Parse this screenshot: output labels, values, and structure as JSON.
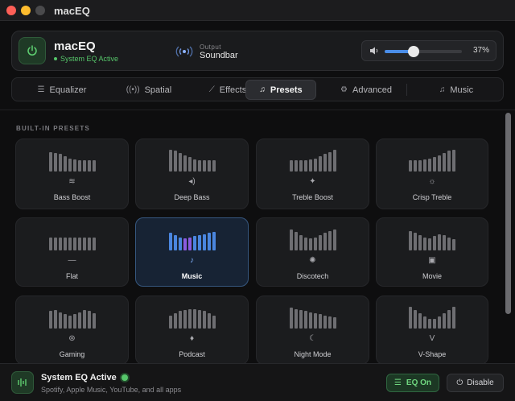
{
  "window": {
    "title": "macEQ"
  },
  "header": {
    "app_name": "macEQ",
    "status": "System EQ Active",
    "output_caption": "Output",
    "output_device": "Soundbar",
    "volume_percent": 37,
    "volume_label": "37%"
  },
  "tabs": [
    {
      "label": "Equalizer",
      "icon": "sliders-icon",
      "glyph": "☰"
    },
    {
      "label": "Spatial",
      "icon": "spatial-audio-icon",
      "glyph": "((•))"
    },
    {
      "label": "Effects",
      "icon": "magic-wand-icon",
      "glyph": "⟋"
    },
    {
      "label": "Presets",
      "icon": "music-list-icon",
      "glyph": "♫",
      "active": true
    },
    {
      "label": "Advanced",
      "icon": "advanced-icon",
      "glyph": "⚙"
    },
    {
      "label": "Music",
      "icon": "music-note-icon",
      "glyph": "♫"
    }
  ],
  "section_label": "BUILT-IN PRESETS",
  "presets": [
    {
      "label": "Bass Boost",
      "icon": "waveform-icon",
      "glyph": "≋",
      "levels": [
        0.9,
        0.85,
        0.8,
        0.7,
        0.6,
        0.55,
        0.5,
        0.5,
        0.5,
        0.5
      ]
    },
    {
      "label": "Deep Bass",
      "icon": "speaker-wave-icon",
      "glyph": "◂)",
      "levels": [
        1.0,
        0.95,
        0.85,
        0.75,
        0.65,
        0.55,
        0.5,
        0.5,
        0.5,
        0.5
      ]
    },
    {
      "label": "Treble Boost",
      "icon": "sparkle-icon",
      "glyph": "✦",
      "levels": [
        0.5,
        0.5,
        0.5,
        0.5,
        0.55,
        0.6,
        0.7,
        0.8,
        0.9,
        1.0
      ]
    },
    {
      "label": "Crisp Treble",
      "icon": "sun-rays-icon",
      "glyph": "☼",
      "levels": [
        0.5,
        0.5,
        0.5,
        0.55,
        0.6,
        0.65,
        0.75,
        0.85,
        0.95,
        1.0
      ]
    },
    {
      "label": "Flat",
      "icon": "minus-icon",
      "glyph": "—",
      "levels": [
        0.6,
        0.6,
        0.6,
        0.6,
        0.6,
        0.6,
        0.6,
        0.6,
        0.6,
        0.6
      ]
    },
    {
      "label": "Music",
      "icon": "music-note-icon",
      "glyph": "♪",
      "selected": true,
      "levels": [
        0.8,
        0.7,
        0.6,
        0.55,
        0.6,
        0.65,
        0.7,
        0.75,
        0.8,
        0.85
      ]
    },
    {
      "label": "Discotech",
      "icon": "party-popper-icon",
      "glyph": "✺",
      "levels": [
        0.95,
        0.85,
        0.7,
        0.6,
        0.55,
        0.6,
        0.7,
        0.8,
        0.9,
        0.95
      ]
    },
    {
      "label": "Movie",
      "icon": "film-icon",
      "glyph": "▣",
      "levels": [
        0.9,
        0.8,
        0.7,
        0.6,
        0.55,
        0.65,
        0.75,
        0.7,
        0.6,
        0.5
      ]
    },
    {
      "label": "Gaming",
      "icon": "gamepad-icon",
      "glyph": "⊛",
      "levels": [
        0.8,
        0.85,
        0.75,
        0.65,
        0.6,
        0.65,
        0.75,
        0.85,
        0.8,
        0.7
      ]
    },
    {
      "label": "Podcast",
      "icon": "microphone-icon",
      "glyph": "♦",
      "levels": [
        0.6,
        0.7,
        0.8,
        0.85,
        0.9,
        0.9,
        0.85,
        0.8,
        0.7,
        0.6
      ]
    },
    {
      "label": "Night Mode",
      "icon": "moon-icon",
      "glyph": "☾",
      "levels": [
        0.95,
        0.9,
        0.85,
        0.8,
        0.75,
        0.7,
        0.65,
        0.6,
        0.55,
        0.5
      ]
    },
    {
      "label": "V-Shape",
      "icon": "v-shape-icon",
      "glyph": "V",
      "levels": [
        1.0,
        0.85,
        0.7,
        0.55,
        0.45,
        0.45,
        0.55,
        0.7,
        0.85,
        1.0
      ]
    }
  ],
  "footer": {
    "title": "System EQ Active",
    "subtitle": "Spotify, Apple Music, YouTube, and all apps",
    "eq_button": "EQ On",
    "disable_button": "Disable"
  },
  "colors": {
    "accent_green": "#56c66a",
    "accent_blue": "#4a86df",
    "accent_purple": "#8b5be0"
  }
}
